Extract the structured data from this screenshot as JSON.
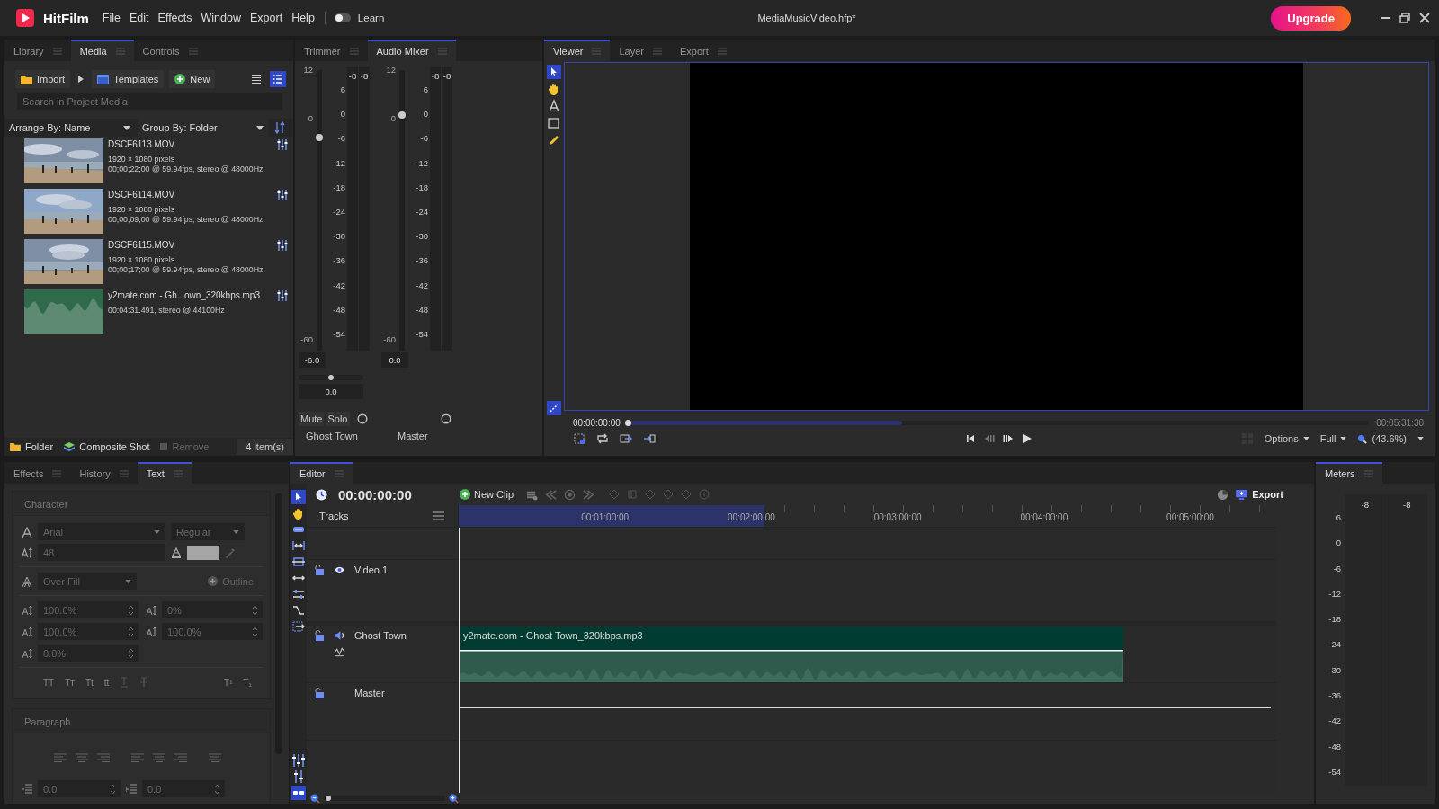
{
  "titlebar": {
    "app_name": "HitFilm",
    "menu": [
      "File",
      "Edit",
      "Effects",
      "Window",
      "Export",
      "Help"
    ],
    "learn": {
      "label": "Learn",
      "on": false
    },
    "project": "MediaMusicVideo.hfp*",
    "upgrade": "Upgrade"
  },
  "media_panel": {
    "tabs": [
      {
        "label": "Library",
        "selected": false
      },
      {
        "label": "Media",
        "selected": true
      },
      {
        "label": "Controls",
        "selected": false
      }
    ],
    "import": "Import",
    "templates": "Templates",
    "new": "New",
    "views": [
      {
        "kind": "list",
        "selected": false
      },
      {
        "kind": "details",
        "selected": true
      }
    ],
    "search": {
      "placeholder": "Search in Project Media"
    },
    "arrange": "Arrange By: Name",
    "group": "Group By: Folder",
    "items": [
      {
        "kind": "video",
        "name": "DSCF6113.MOV",
        "lines": [
          "1920 × 1080 pixels",
          "00;00;22;00 @ 59.94fps, stereo @ 48000Hz"
        ]
      },
      {
        "kind": "video",
        "name": "DSCF6114.MOV",
        "lines": [
          "1920 × 1080 pixels",
          "00;00;09;00 @ 59.94fps, stereo @ 48000Hz"
        ]
      },
      {
        "kind": "video",
        "name": "DSCF6115.MOV",
        "lines": [
          "1920 × 1080 pixels",
          "00;00;17;00 @ 59.94fps, stereo @ 48000Hz"
        ]
      },
      {
        "kind": "audio",
        "name": "y2mate.com - Gh...own_320kbps.mp3",
        "lines": [
          "00:04:31.491, stereo @ 44100Hz"
        ]
      }
    ],
    "folder": "Folder",
    "composite_shot": "Composite Shot",
    "remove": {
      "label": "Remove",
      "disabled": true
    },
    "count": "4 item(s)"
  },
  "mixer_panel": {
    "tabs": [
      {
        "label": "Trimmer",
        "selected": false
      },
      {
        "label": "Audio Mixer",
        "selected": true
      }
    ],
    "channels": [
      {
        "name": "Ghost Town",
        "fader_scale": [
          "12",
          "0",
          "-60"
        ],
        "meter_scale": [
          "6",
          "0",
          "-6",
          "-12",
          "-18",
          "-24",
          "-30",
          "-36",
          "-42",
          "-48",
          "-54"
        ],
        "peaks": [
          "-8",
          "-8"
        ],
        "gain": "-6.0",
        "level": 0.76,
        "pan": {
          "level": 0.5,
          "reading": "0.0"
        },
        "mute": "Mute",
        "solo": "Solo"
      },
      {
        "name": "Master",
        "fader_scale": [
          "12",
          "0",
          "-60"
        ],
        "meter_scale": [
          "6",
          "0",
          "-6",
          "-12",
          "-18",
          "-24",
          "-30",
          "-36",
          "-42",
          "-48",
          "-54"
        ],
        "peaks": [
          "-8",
          "-8"
        ],
        "gain": "0.0",
        "level": 0.84
      }
    ]
  },
  "viewer_panel": {
    "tabs": [
      {
        "label": "Viewer",
        "selected": true
      },
      {
        "label": "Layer",
        "selected": false
      },
      {
        "label": "Export",
        "selected": false
      }
    ],
    "timecode": "00:00:00:00",
    "duration": "00:05:31:30",
    "playhead": {
      "level": 0
    },
    "options": "Options",
    "quality": "Full",
    "zoom": "(43.6%)"
  },
  "text_panel": {
    "tabs": [
      {
        "label": "Effects",
        "selected": false
      },
      {
        "label": "History",
        "selected": false
      },
      {
        "label": "Text",
        "selected": true
      }
    ],
    "character": {
      "title": "Character",
      "font": "Arial",
      "style": "Regular",
      "size": "48",
      "fill_mode": "Over Fill",
      "outline": "Outline",
      "fields": [
        "100.0%",
        "0%",
        "100.0%",
        "100.0%",
        "0.0%"
      ],
      "case_buttons": [
        "TT",
        "Tт",
        "Tt",
        "tt"
      ],
      "script_buttons": [
        "T¹",
        "T₁"
      ]
    },
    "paragraph": {
      "title": "Paragraph",
      "fields": [
        "0.0",
        "0.0"
      ]
    }
  },
  "editor_panel": {
    "tab": "Editor",
    "zoom": {
      "level": 0.04
    },
    "timecode": "00:00:00:00",
    "new_clip": "New Clip",
    "export": "Export",
    "tracks_label": "Tracks",
    "ruler": [
      "00:01:00:00",
      "00:02:00:00",
      "00:03:00:00",
      "00:04:00:00",
      "00:05:00:00"
    ],
    "tracks": [
      {
        "kind": "video",
        "name": "Video 1"
      },
      {
        "kind": "audio",
        "name": "Ghost Town",
        "clip": "y2mate.com - Ghost Town_320kbps.mp3"
      },
      {
        "kind": "master",
        "name": "Master"
      }
    ]
  },
  "meters_panel": {
    "tab": "Meters",
    "peaks": [
      "-8",
      "-8"
    ],
    "scale": [
      "6",
      "0",
      "-6",
      "-12",
      "-18",
      "-24",
      "-30",
      "-36",
      "-42",
      "-48",
      "-54"
    ]
  }
}
